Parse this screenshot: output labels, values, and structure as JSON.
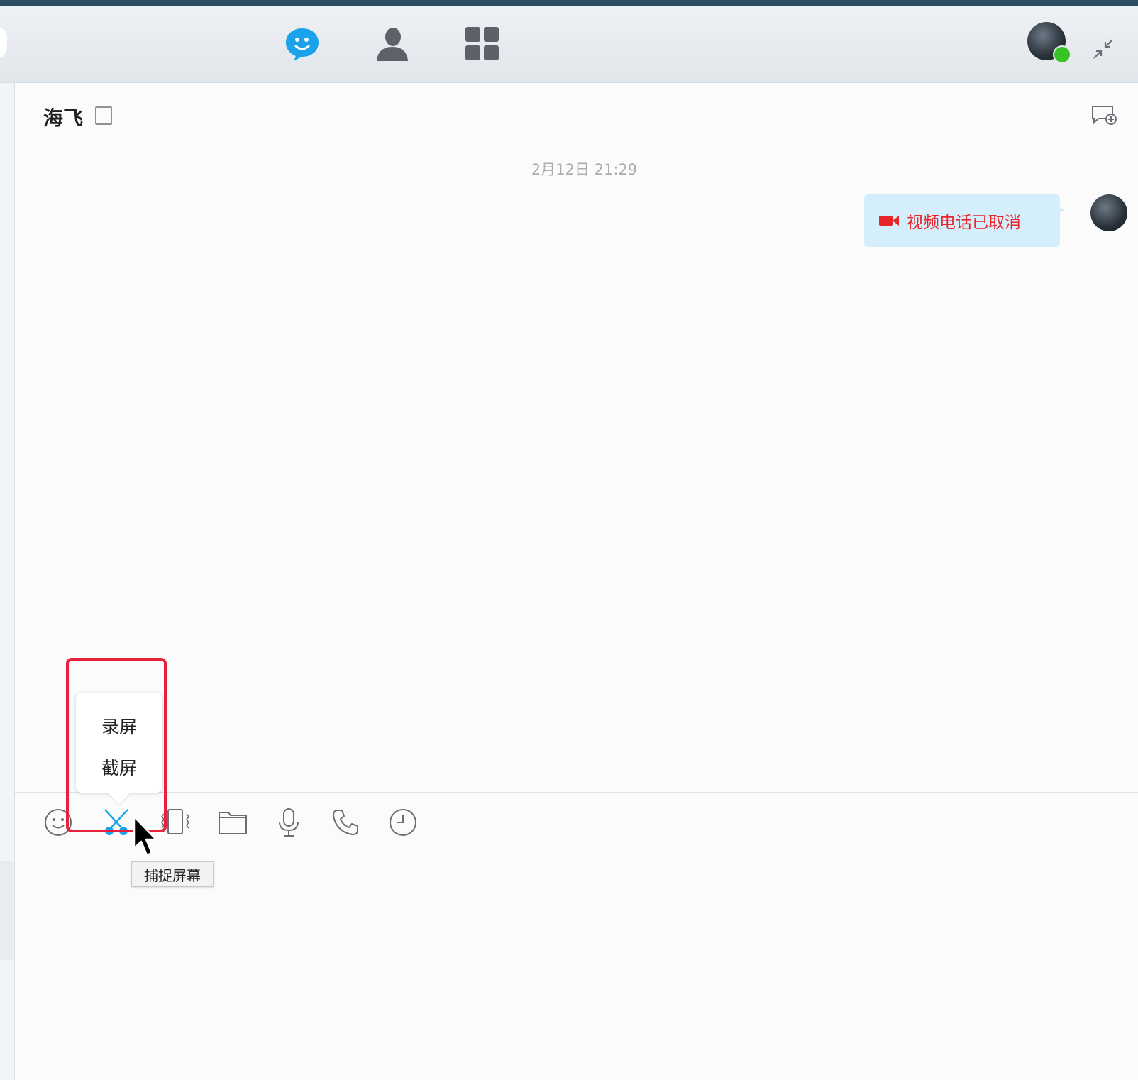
{
  "topbar": {
    "nav": [
      {
        "name": "chat-tab",
        "icon": "chat-bubble-icon",
        "active": true,
        "color": "#1aa3ea"
      },
      {
        "name": "contacts-tab",
        "icon": "person-icon",
        "active": false,
        "color": "#5d6168"
      },
      {
        "name": "apps-tab",
        "icon": "grid-icon",
        "active": false,
        "color": "#5d6168"
      }
    ],
    "status_color": "#36c324"
  },
  "chat": {
    "contact_name": "海飞",
    "timestamp": "2月12日  21:29",
    "messages": [
      {
        "direction": "outgoing",
        "icon": "video-camera-icon",
        "text": "视频电话已取消",
        "text_color": "#e8252b",
        "bubble_color": "#d4eefb"
      }
    ]
  },
  "toolbar": {
    "items": [
      {
        "name": "emoji-button",
        "icon": "smiley-icon"
      },
      {
        "name": "screenshot-button",
        "icon": "scissors-icon",
        "active": true,
        "color": "#1aa3ea"
      },
      {
        "name": "shake-button",
        "icon": "vibrate-icon"
      },
      {
        "name": "file-button",
        "icon": "folder-icon"
      },
      {
        "name": "voice-button",
        "icon": "microphone-icon"
      },
      {
        "name": "call-button",
        "icon": "phone-icon"
      },
      {
        "name": "history-button",
        "icon": "clock-icon"
      }
    ],
    "popup_menu": [
      "录屏",
      "截屏"
    ],
    "tooltip": "捕捉屏幕",
    "highlight_color": "#e8223a"
  }
}
